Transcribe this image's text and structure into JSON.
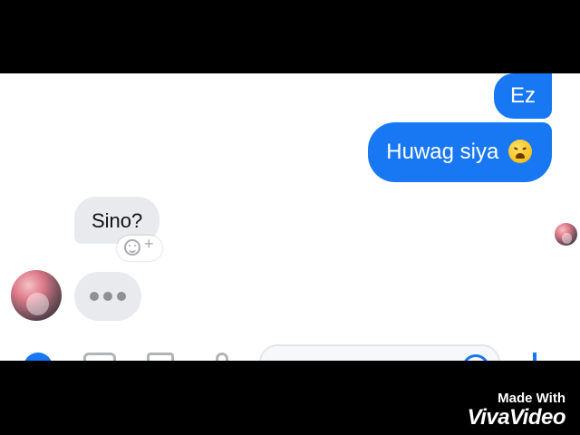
{
  "conversation": {
    "outgoing": [
      {
        "text": "Ez"
      },
      {
        "text": "Huwag siya",
        "emoji": "weary-face-emoji"
      }
    ],
    "incoming": [
      {
        "text": "Sino?"
      }
    ],
    "typing_indicator": "•••"
  },
  "reaction": {
    "icon": "add-reaction-icon",
    "plus": "+"
  },
  "composer": {
    "icons": [
      "plus-icon",
      "camera-icon",
      "photo-icon",
      "microphone-icon",
      "emoji-icon",
      "like-icon"
    ]
  },
  "watermark": {
    "line1": "Made With",
    "line2": "VivaVideo"
  },
  "colors": {
    "accent": "#1877f2",
    "incoming_bubble": "#e9eaed",
    "letterbox": "#000000"
  }
}
